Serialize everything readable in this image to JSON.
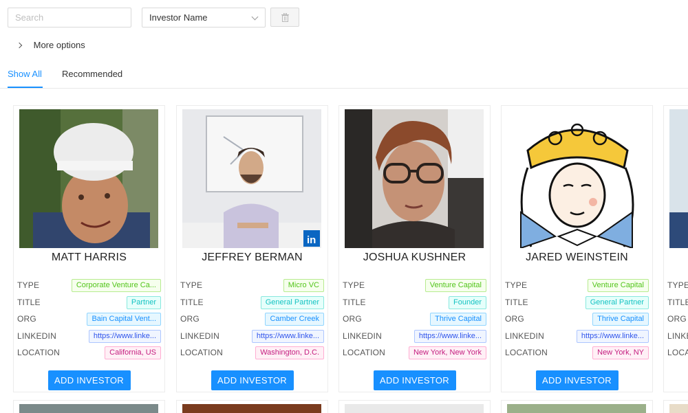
{
  "toolbar": {
    "search_placeholder": "Search",
    "select_value": "Investor Name",
    "more_options_label": "More options"
  },
  "tabs": [
    {
      "label": "Show All",
      "active": true
    },
    {
      "label": "Recommended",
      "active": false
    }
  ],
  "field_labels": {
    "type": "TYPE",
    "title": "TITLE",
    "org": "ORG",
    "linkedin": "LINKEDIN",
    "location": "LOCATION"
  },
  "add_label": "ADD INVESTOR",
  "cards": [
    {
      "name": "MATT HARRIS",
      "type": "Corporate Venture Ca...",
      "title": "Partner",
      "org": "Bain Capital Vent...",
      "linkedin": "https://www.linke...",
      "location": "California, US"
    },
    {
      "name": "JEFFREY BERMAN",
      "type": "Micro VC",
      "title": "General Partner",
      "org": "Camber Creek",
      "linkedin": "https://www.linke...",
      "location": "Washington, D.C."
    },
    {
      "name": "JOSHUA KUSHNER",
      "type": "Venture Capital",
      "title": "Founder",
      "org": "Thrive Capital",
      "linkedin": "https://www.linke...",
      "location": "New York, New York"
    },
    {
      "name": "JARED WEINSTEIN",
      "type": "Venture Capital",
      "title": "General Partner",
      "org": "Thrive Capital",
      "linkedin": "https://www.linke...",
      "location": "New York, NY"
    },
    {
      "name": "",
      "type": "",
      "title": "",
      "org": "",
      "linkedin": "",
      "location": ""
    }
  ],
  "colors": {
    "primary": "#1890ff",
    "type_tag": "#52c41a",
    "title_tag": "#13c2c2",
    "org_tag": "#1890ff",
    "linkedin_tag": "#2f54eb",
    "location_tag": "#c41d7f"
  }
}
